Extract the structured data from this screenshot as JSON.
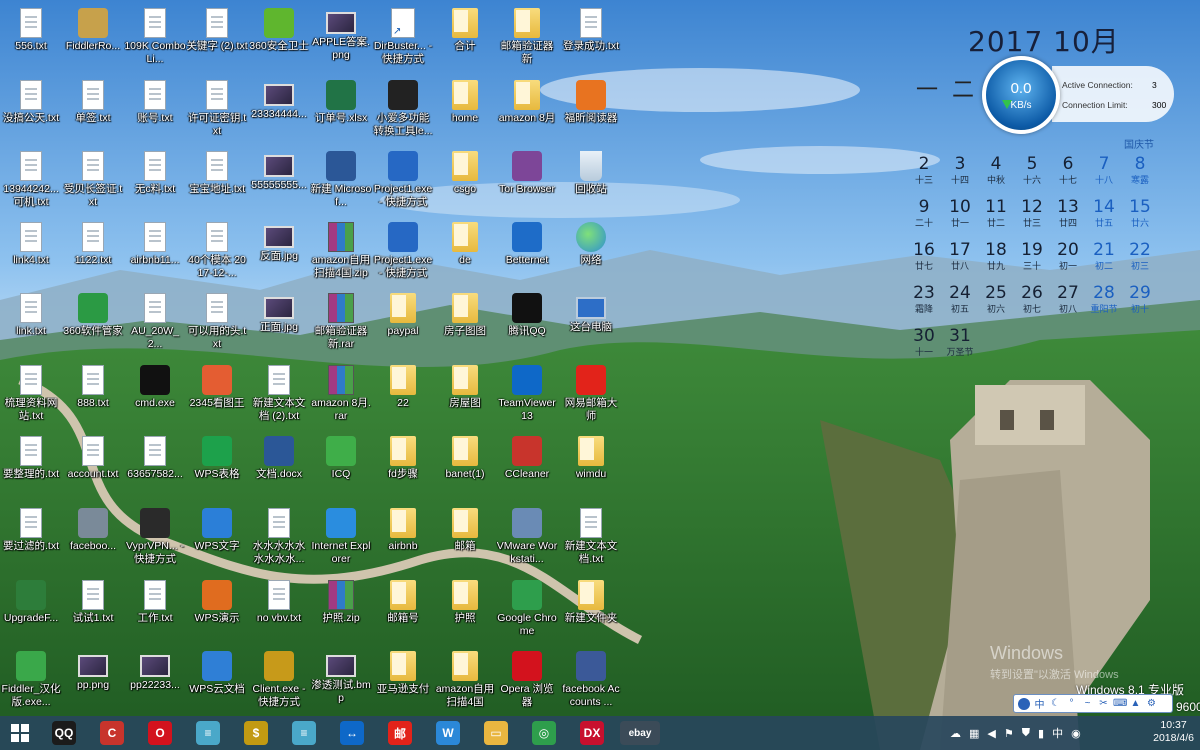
{
  "desktop_icons": {
    "columns": [
      [
        {
          "label": "556.txt",
          "icon": "text-file-icon"
        },
        {
          "label": "没搞公天.txt",
          "icon": "text-file-icon"
        },
        {
          "label": "13944242...可机.txt",
          "icon": "text-file-icon"
        },
        {
          "label": "link4.txt",
          "icon": "text-file-icon"
        },
        {
          "label": "link.txt",
          "icon": "text-file-icon"
        },
        {
          "label": "梳理资料网站.txt",
          "icon": "text-file-icon"
        },
        {
          "label": "要整理的.txt",
          "icon": "text-file-icon"
        },
        {
          "label": "要过滤的.txt",
          "icon": "text-file-icon"
        },
        {
          "label": "UpgradeF...",
          "icon": "installer-icon"
        },
        {
          "label": "Fiddler_汉化版.exe...",
          "icon": "fiddler-icon"
        }
      ],
      [
        {
          "label": "FiddlerRo...",
          "icon": "certificate-icon"
        },
        {
          "label": "单签.txt",
          "icon": "text-file-icon"
        },
        {
          "label": "受贝长签证.txt",
          "icon": "text-file-icon"
        },
        {
          "label": "1122.txt",
          "icon": "text-file-icon"
        },
        {
          "label": "360软件管家",
          "icon": "360-manager-icon"
        },
        {
          "label": "888.txt",
          "icon": "text-file-icon"
        },
        {
          "label": "account.txt",
          "icon": "text-file-icon"
        },
        {
          "label": "faceboo...",
          "icon": "email-icon"
        },
        {
          "label": "试试1.txt",
          "icon": "text-file-icon"
        },
        {
          "label": "pp.png",
          "icon": "image-file-icon"
        }
      ],
      [
        {
          "label": "109K Combo Li...",
          "icon": "text-file-icon"
        },
        {
          "label": "账号.txt",
          "icon": "text-file-icon"
        },
        {
          "label": "无c料.txt",
          "icon": "text-file-icon"
        },
        {
          "label": "airbnb11...",
          "icon": "text-file-icon"
        },
        {
          "label": "AU_20W_2...",
          "icon": "text-file-icon"
        },
        {
          "label": "cmd.exe",
          "icon": "cmd-icon"
        },
        {
          "label": "63657582...",
          "icon": "text-file-icon"
        },
        {
          "label": "VyprVPN... - 快捷方式",
          "icon": "vpn-icon"
        },
        {
          "label": "工作.txt",
          "icon": "text-file-icon"
        },
        {
          "label": "pp22233...",
          "icon": "image-file-icon"
        }
      ],
      [
        {
          "label": "关键字 (2).txt",
          "icon": "text-file-icon"
        },
        {
          "label": "许可证密钥.txt",
          "icon": "text-file-icon"
        },
        {
          "label": "宝宝地址.txt",
          "icon": "text-file-icon"
        },
        {
          "label": "40个模本 2017-12-...",
          "icon": "text-file-icon"
        },
        {
          "label": "可以用的头.txt",
          "icon": "text-file-icon"
        },
        {
          "label": "2345看图王",
          "icon": "image-viewer-icon"
        },
        {
          "label": "WPS表格",
          "icon": "wps-sheet-icon"
        },
        {
          "label": "WPS文字",
          "icon": "wps-writer-icon"
        },
        {
          "label": "WPS演示",
          "icon": "wps-slides-icon"
        },
        {
          "label": "WPS云文档",
          "icon": "wps-cloud-icon"
        }
      ],
      [
        {
          "label": "360安全卫士",
          "icon": "360-security-icon"
        },
        {
          "label": "23334444...",
          "icon": "image-file-icon"
        },
        {
          "label": "55555555...",
          "icon": "image-file-icon"
        },
        {
          "label": "反面.jpg",
          "icon": "image-file-icon"
        },
        {
          "label": "正面.jpg",
          "icon": "image-file-icon"
        },
        {
          "label": "新建文本文档 (2).txt",
          "icon": "text-file-icon"
        },
        {
          "label": "文档.docx",
          "icon": "word-doc-icon"
        },
        {
          "label": "水水水水水水水水水...",
          "icon": "text-file-icon"
        },
        {
          "label": "no vbv.txt",
          "icon": "text-file-icon"
        },
        {
          "label": "Client.exe - 快捷方式",
          "icon": "client-icon"
        }
      ],
      [
        {
          "label": "APPLE答案.png",
          "icon": "image-file-icon"
        },
        {
          "label": "订单号.xlsx",
          "icon": "excel-icon"
        },
        {
          "label": "新建 Microsof...",
          "icon": "word-doc-icon"
        },
        {
          "label": "amazon自用扫描4国.zip",
          "icon": "archive-icon"
        },
        {
          "label": "邮箱验证器 新.rar",
          "icon": "archive-icon"
        },
        {
          "label": "amazon 8月.rar",
          "icon": "archive-icon"
        },
        {
          "label": "ICQ",
          "icon": "icq-icon"
        },
        {
          "label": "Internet Explorer",
          "icon": "ie-icon"
        },
        {
          "label": "护照.zip",
          "icon": "archive-icon"
        },
        {
          "label": "渗透测试.bmp",
          "icon": "image-file-icon"
        }
      ],
      [
        {
          "label": "DirBuster... - 快捷方式",
          "icon": "shortcut-icon"
        },
        {
          "label": "小爱多功能转换工具le...",
          "icon": "converter-icon"
        },
        {
          "label": "Project1.exe - 快捷方式",
          "icon": "star-shortcut-icon"
        },
        {
          "label": "Project1.exe - 快捷方式",
          "icon": "star-shortcut-icon"
        },
        {
          "label": "paypal",
          "icon": "folder-icon"
        },
        {
          "label": "22",
          "icon": "folder-icon"
        },
        {
          "label": "fd步骤",
          "icon": "folder-icon"
        },
        {
          "label": "airbnb",
          "icon": "folder-icon"
        },
        {
          "label": "邮箱号",
          "icon": "folder-icon"
        },
        {
          "label": "亚马逊支付",
          "icon": "folder-icon"
        }
      ],
      [
        {
          "label": "合计",
          "icon": "folder-icon"
        },
        {
          "label": "home",
          "icon": "folder-icon"
        },
        {
          "label": "csgo",
          "icon": "folder-icon"
        },
        {
          "label": "de",
          "icon": "folder-icon"
        },
        {
          "label": "房子图图",
          "icon": "folder-icon"
        },
        {
          "label": "房屋图",
          "icon": "folder-icon"
        },
        {
          "label": "banet(1)",
          "icon": "folder-icon"
        },
        {
          "label": "邮箱",
          "icon": "folder-icon"
        },
        {
          "label": "护照",
          "icon": "folder-icon"
        },
        {
          "label": "amazon自用扫描4国",
          "icon": "folder-icon"
        }
      ],
      [
        {
          "label": "邮箱验证器 新",
          "icon": "folder-icon"
        },
        {
          "label": "amazon 8月",
          "icon": "folder-icon"
        },
        {
          "label": "Tor Browser",
          "icon": "tor-icon"
        },
        {
          "label": "Betternet",
          "icon": "betternet-icon"
        },
        {
          "label": "腾讯QQ",
          "icon": "qq-icon"
        },
        {
          "label": "TeamViewer 13",
          "icon": "teamviewer-icon"
        },
        {
          "label": "CCleaner",
          "icon": "ccleaner-icon"
        },
        {
          "label": "VMware Workstati...",
          "icon": "vmware-icon"
        },
        {
          "label": "Google Chrome",
          "icon": "chrome-icon"
        },
        {
          "label": "Opera 浏览器",
          "icon": "opera-icon"
        }
      ],
      [
        {
          "label": "登录成功.txt",
          "icon": "text-file-icon"
        },
        {
          "label": "福昕阅读器",
          "icon": "foxit-icon"
        },
        {
          "label": "回收站",
          "icon": "recycle-bin-icon"
        },
        {
          "label": "网络",
          "icon": "network-icon"
        },
        {
          "label": "这台电脑",
          "icon": "this-pc-icon"
        },
        {
          "label": "网易邮箱大师",
          "icon": "netease-mail-icon"
        },
        {
          "label": "wimdu",
          "icon": "folder-icon"
        },
        {
          "label": "新建文本文档.txt",
          "icon": "text-file-icon"
        },
        {
          "label": "新建文件夹",
          "icon": "folder-icon"
        },
        {
          "label": "facebook Accounts ...",
          "icon": "facebook-icon"
        }
      ]
    ]
  },
  "calendar": {
    "header": "2017 10月",
    "dashes": [
      "一",
      "二"
    ],
    "speed": {
      "rate": "0.0",
      "unit": "KB/s"
    },
    "active_connection_label": "Active Connection:",
    "active_connection_value": "3",
    "connection_limit_label": "Connection Limit:",
    "connection_limit_value": "300",
    "holiday_link": "国庆节",
    "weeks": [
      [
        {
          "d": "2",
          "s": "十三"
        },
        {
          "d": "3",
          "s": "十四"
        },
        {
          "d": "4",
          "s": "中秋"
        },
        {
          "d": "5",
          "s": "十六"
        },
        {
          "d": "6",
          "s": "十七"
        },
        {
          "d": "7",
          "s": "十八",
          "w": true
        },
        {
          "d": "8",
          "s": "寒露",
          "w": true
        }
      ],
      [
        {
          "d": "9",
          "s": "二十"
        },
        {
          "d": "10",
          "s": "廿一"
        },
        {
          "d": "11",
          "s": "廿二"
        },
        {
          "d": "12",
          "s": "廿三"
        },
        {
          "d": "13",
          "s": "廿四"
        },
        {
          "d": "14",
          "s": "廿五",
          "w": true
        },
        {
          "d": "15",
          "s": "廿六",
          "w": true
        }
      ],
      [
        {
          "d": "16",
          "s": "廿七"
        },
        {
          "d": "17",
          "s": "廿八"
        },
        {
          "d": "18",
          "s": "廿九"
        },
        {
          "d": "19",
          "s": "三十"
        },
        {
          "d": "20",
          "s": "初一"
        },
        {
          "d": "21",
          "s": "初二",
          "w": true
        },
        {
          "d": "22",
          "s": "初三",
          "w": true
        }
      ],
      [
        {
          "d": "23",
          "s": "霜降"
        },
        {
          "d": "24",
          "s": "初五"
        },
        {
          "d": "25",
          "s": "初六"
        },
        {
          "d": "26",
          "s": "初七"
        },
        {
          "d": "27",
          "s": "初八"
        },
        {
          "d": "28",
          "s": "重阳节",
          "w": true
        },
        {
          "d": "29",
          "s": "初十",
          "w": true
        }
      ],
      [
        {
          "d": "30",
          "s": "十一"
        },
        {
          "d": "31",
          "s": "万圣节"
        }
      ]
    ]
  },
  "watermark": {
    "line1": "Windows",
    "line2": "转到设置\"以激活 Windows",
    "edition": "Windows 8.1 专业版",
    "build": "9600"
  },
  "ime_bar": {
    "mode": "中"
  },
  "taskbar": {
    "apps": [
      {
        "name": "qq",
        "label": "QQ",
        "color": "#1b1b1b"
      },
      {
        "name": "ccleaner",
        "label": "C",
        "color": "#c8342c"
      },
      {
        "name": "opera",
        "label": "O",
        "color": "#d3121d"
      },
      {
        "name": "notepad",
        "label": "≡",
        "color": "#4aa8c9"
      },
      {
        "name": "client-exe",
        "label": "$",
        "color": "#c29a12"
      },
      {
        "name": "notepad-2",
        "label": "≡",
        "color": "#4aa8c9"
      },
      {
        "name": "teamviewer",
        "label": "↔",
        "color": "#0e68c8"
      },
      {
        "name": "netease-mail",
        "label": "邮",
        "color": "#e2231a"
      },
      {
        "name": "wps",
        "label": "W",
        "color": "#2b88d8"
      },
      {
        "name": "file-explorer",
        "label": "▭",
        "color": "#e9b640"
      },
      {
        "name": "chrome",
        "label": "◎",
        "color": "#2e9e4c"
      },
      {
        "name": "dx",
        "label": "DX",
        "color": "#c8102e"
      },
      {
        "name": "ebay",
        "label": "ebay",
        "color": "#3b4b58"
      }
    ],
    "tray_lang": "中",
    "time": "10:37",
    "date": "2018/4/6"
  }
}
